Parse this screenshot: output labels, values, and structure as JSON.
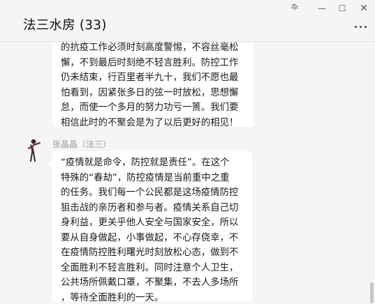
{
  "window": {
    "title": "法三水房 (33)",
    "controls": {
      "pin_glyph": "卆",
      "minimize_glyph": "—",
      "maximize_glyph": "☐",
      "close_glyph": "✕"
    }
  },
  "messages": [
    {
      "sender": "",
      "lines": [
        "的抗疫工作必须时刻高度警惕，不容丝毫松",
        "懈，不到最后时刻绝不轻言胜利。防控工作",
        "仍未结束，行百里者半九十，我们不愿也最",
        "怕看到，因紧张多日的弦一时放松，思想懈",
        "怠，而使一个多月的努力功亏一篑。我们要",
        "相信此时的不聚会是为了以后更好的相见！"
      ]
    },
    {
      "sender": "张晶晶（法三）",
      "lines": [
        "“疫情就是命令，防控就是责任”。在这个",
        "特殊的“春劫”，防控疫情是当前重中之重",
        "的任务。我们每一个公民都是这场疫情防控",
        "狙击战的亲历者和参与者。疫情关系自己切",
        "身利益，更关乎他人安全与国家安全，所以",
        "要从自身做起，小事做起，不心存侥幸，不",
        "在疫情防控胜利曙光时刻放松心态，做到不",
        "全面胜利不轻言胜利。同时注意个人卫生，",
        "公共场所佩戴口罩，不聚集，不去人多场所",
        "，等待全面胜利的一天。"
      ]
    }
  ],
  "colors": {
    "background": "#f5f5f5",
    "bubble": "#ffffff",
    "sender_text": "#9a9a9a",
    "text": "#1a1a1a"
  }
}
